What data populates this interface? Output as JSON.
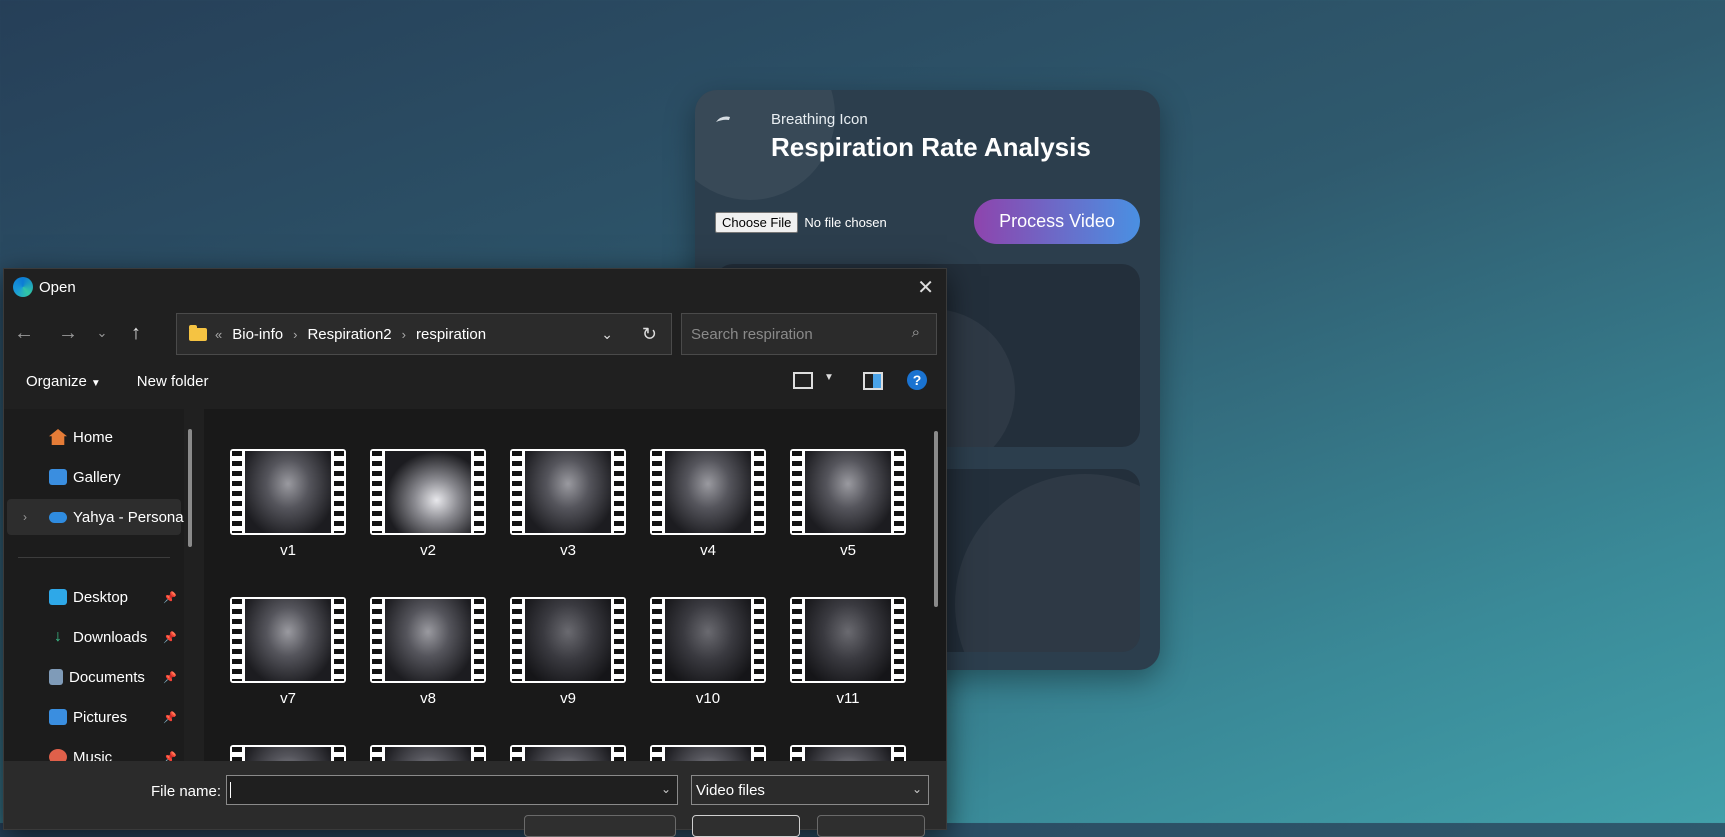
{
  "app": {
    "logo_alt": "Breathing Icon",
    "title": "Respiration Rate Analysis",
    "choose_file_label": "Choose File",
    "no_file_text": "No file chosen",
    "process_button": "Process Video"
  },
  "dialog": {
    "title": "Open",
    "breadcrumb": {
      "overflow": "«",
      "items": [
        "Bio-info",
        "Respiration2",
        "respiration"
      ]
    },
    "search_placeholder": "Search respiration",
    "toolbar": {
      "organize": "Organize",
      "new_folder": "New folder",
      "help": "?"
    },
    "sidebar": {
      "items": [
        "Home",
        "Gallery",
        "Yahya - Personal",
        "Desktop",
        "Downloads",
        "Documents",
        "Pictures",
        "Music"
      ]
    },
    "files": [
      "v1",
      "v2",
      "v3",
      "v4",
      "v5",
      "v7",
      "v8",
      "v9",
      "v10",
      "v11"
    ],
    "file_name_label": "File name:",
    "file_name_value": "",
    "file_type": "Video files"
  }
}
